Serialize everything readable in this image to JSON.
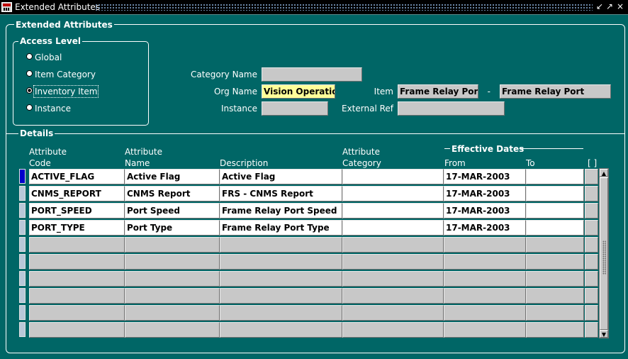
{
  "window": {
    "title": "Extended Attributes"
  },
  "frame_label": "Extended Attributes",
  "access_level": {
    "label": "Access Level",
    "options": [
      {
        "label": "Global",
        "selected": false
      },
      {
        "label": "Item Category",
        "selected": false
      },
      {
        "label": "Inventory Item",
        "selected": true
      },
      {
        "label": "Instance",
        "selected": false
      }
    ]
  },
  "fields": {
    "category_name": {
      "label": "Category Name",
      "value": ""
    },
    "org_name": {
      "label": "Org Name",
      "value": "Vision Operations"
    },
    "instance": {
      "label": "Instance",
      "value": ""
    },
    "item": {
      "label": "Item",
      "value": "Frame Relay Port",
      "separator": "-",
      "description": "Frame Relay Port"
    },
    "external_ref": {
      "label": "External Ref",
      "value": ""
    }
  },
  "details": {
    "label": "Details",
    "columns": {
      "attr_code": {
        "line1": "Attribute",
        "line2": "Code"
      },
      "attr_name": {
        "line1": "Attribute",
        "line2": "Name"
      },
      "description": {
        "line1": "",
        "line2": "Description"
      },
      "attr_category": {
        "line1": "Attribute",
        "line2": "Category"
      },
      "effective_dates": "Effective Dates",
      "from": "From",
      "to": "To",
      "dff": "[ ]"
    },
    "rows": [
      {
        "code": "ACTIVE_FLAG",
        "name": "Active Flag",
        "description": "Active Flag",
        "category": "",
        "from": "17-MAR-2003",
        "to": ""
      },
      {
        "code": "CNMS_REPORT",
        "name": "CNMS Report",
        "description": "FRS - CNMS Report",
        "category": "",
        "from": "17-MAR-2003",
        "to": ""
      },
      {
        "code": "PORT_SPEED",
        "name": "Port Speed",
        "description": "Frame Relay Port Speed",
        "category": "",
        "from": "17-MAR-2003",
        "to": ""
      },
      {
        "code": "PORT_TYPE",
        "name": "Port Type",
        "description": "Frame Relay Port Type",
        "category": "",
        "from": "17-MAR-2003",
        "to": ""
      },
      {
        "code": "",
        "name": "",
        "description": "",
        "category": "",
        "from": "",
        "to": ""
      },
      {
        "code": "",
        "name": "",
        "description": "",
        "category": "",
        "from": "",
        "to": ""
      },
      {
        "code": "",
        "name": "",
        "description": "",
        "category": "",
        "from": "",
        "to": ""
      },
      {
        "code": "",
        "name": "",
        "description": "",
        "category": "",
        "from": "",
        "to": ""
      },
      {
        "code": "",
        "name": "",
        "description": "",
        "category": "",
        "from": "",
        "to": ""
      },
      {
        "code": "",
        "name": "",
        "description": "",
        "category": "",
        "from": "",
        "to": ""
      }
    ]
  },
  "icons": {
    "app": "oracle-forms-icon",
    "minimize": "minimize-icon",
    "maximize": "maximize-icon",
    "close": "close-icon"
  },
  "colors": {
    "background": "#006666",
    "field": "#c8c8c8",
    "active_field": "#ffff99",
    "row_indicator_current": "#0000cc"
  }
}
